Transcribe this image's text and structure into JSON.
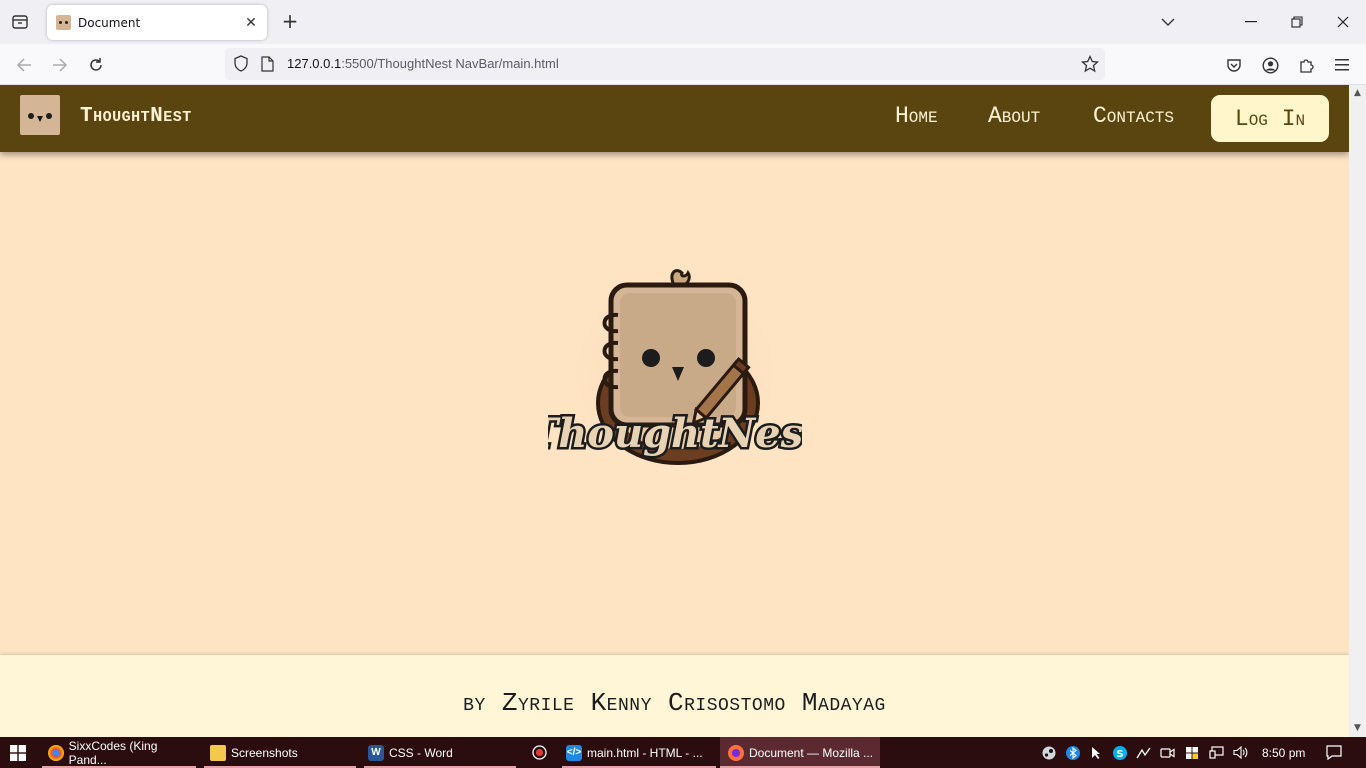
{
  "browser": {
    "tab_title": "Document",
    "url_host": "127.0.0.1",
    "url_rest": ":5500/ThoughtNest NavBar/main.html"
  },
  "site": {
    "brand": "ThoughtNest",
    "nav": [
      "Home",
      "About",
      "Contacts"
    ],
    "login_label": "Log In",
    "hero_logo_text": "ThoughtNest",
    "footer_credit": "by Zyrile Kenny Crisostomo Madayag"
  },
  "taskbar": {
    "items": [
      {
        "label": "SixxCodes (King Pand...",
        "icon": "chrome-icon"
      },
      {
        "label": "Screenshots",
        "icon": "folder-icon"
      },
      {
        "label": "CSS - Word",
        "icon": "word-icon"
      },
      {
        "label": "main.html - HTML - ...",
        "icon": "vscode-icon"
      },
      {
        "label": "Document — Mozilla ...",
        "icon": "firefox-icon"
      }
    ],
    "clock": "8:50 pm"
  },
  "colors": {
    "header": "#5a4510",
    "page_bg": "#ffe4c4",
    "footer_bg": "#fff6d8",
    "login_bg": "#fff6cc",
    "logo_tan": "#d4b596"
  }
}
